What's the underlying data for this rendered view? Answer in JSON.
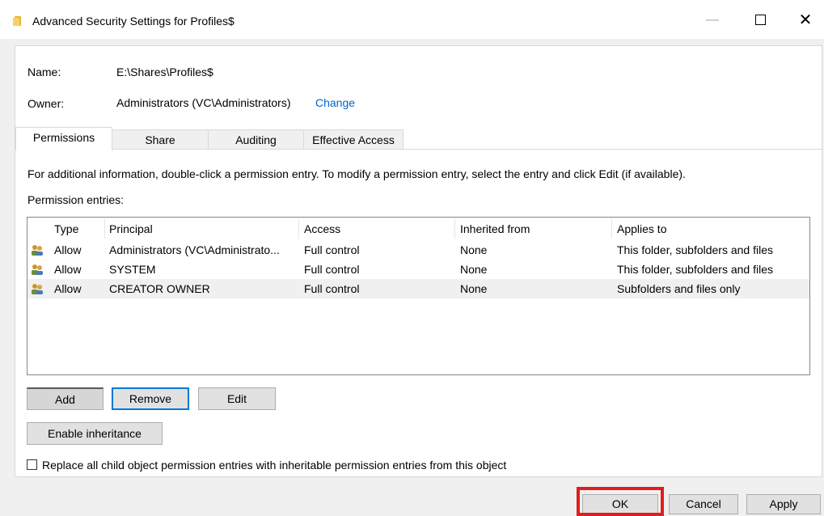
{
  "window": {
    "title": "Advanced Security Settings for Profiles$",
    "minimize": "—",
    "close": "✕"
  },
  "info": {
    "name_label": "Name:",
    "name_value": "E:\\Shares\\Profiles$",
    "owner_label": "Owner:",
    "owner_value": "Administrators (VC\\Administrators)",
    "owner_change": "Change"
  },
  "tabs": [
    {
      "label": "Permissions"
    },
    {
      "label": "Share"
    },
    {
      "label": "Auditing"
    },
    {
      "label": "Effective Access"
    }
  ],
  "description": "For additional information, double-click a permission entry. To modify a permission entry, select the entry and click Edit (if available).",
  "entries_label": "Permission entries:",
  "table": {
    "headers": [
      "Type",
      "Principal",
      "Access",
      "Inherited from",
      "Applies to"
    ],
    "rows": [
      {
        "type": "Allow",
        "principal": "Administrators (VC\\Administrato...",
        "access": "Full control",
        "inherited": "None",
        "applies": "This folder, subfolders and files"
      },
      {
        "type": "Allow",
        "principal": "SYSTEM",
        "access": "Full control",
        "inherited": "None",
        "applies": "This folder, subfolders and files"
      },
      {
        "type": "Allow",
        "principal": "CREATOR OWNER",
        "access": "Full control",
        "inherited": "None",
        "applies": "Subfolders and files only"
      }
    ]
  },
  "buttons": {
    "add": "Add",
    "remove": "Remove",
    "edit": "Edit",
    "enable_inheritance": "Enable inheritance",
    "ok": "OK",
    "cancel": "Cancel",
    "apply": "Apply"
  },
  "replace_checkbox_label": "Replace all child object permission entries with inheritable permission entries from this object",
  "colors": {
    "link": "#0066cc",
    "focus_border": "#0078d7",
    "annotation": "#e11d1d"
  }
}
